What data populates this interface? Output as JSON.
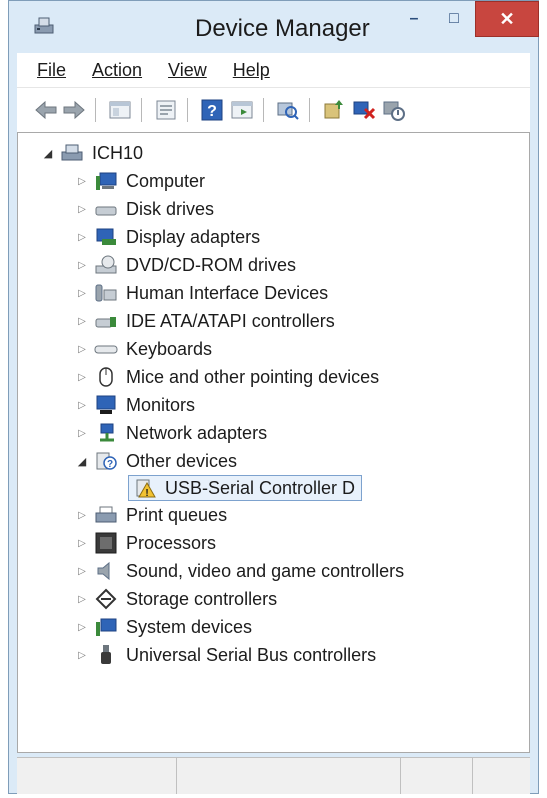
{
  "window": {
    "title": "Device Manager",
    "controls": {
      "minimize": "–",
      "maximize": "□",
      "close": "✕"
    }
  },
  "menu": [
    "File",
    "Action",
    "View",
    "Help"
  ],
  "toolbar": {
    "buttons": [
      "back-icon",
      "forward-icon",
      "show-hide-console-tree-icon",
      "properties-icon",
      "help-icon",
      "action-pane-icon",
      "scan-hardware-changes-icon",
      "update-driver-icon",
      "uninstall-device-icon",
      "disable-device-icon"
    ]
  },
  "tree": {
    "root": "ICH10",
    "categories": [
      {
        "label": "Computer",
        "icon": "computer-icon"
      },
      {
        "label": "Disk drives",
        "icon": "disk-drive-icon"
      },
      {
        "label": "Display adapters",
        "icon": "display-adapter-icon"
      },
      {
        "label": "DVD/CD-ROM drives",
        "icon": "dvd-drive-icon"
      },
      {
        "label": "Human Interface Devices",
        "icon": "hid-icon"
      },
      {
        "label": "IDE ATA/ATAPI controllers",
        "icon": "ide-controller-icon"
      },
      {
        "label": "Keyboards",
        "icon": "keyboard-icon"
      },
      {
        "label": "Mice and other pointing devices",
        "icon": "mouse-icon"
      },
      {
        "label": "Monitors",
        "icon": "monitor-icon"
      },
      {
        "label": "Network adapters",
        "icon": "network-adapter-icon"
      },
      {
        "label": "Other devices",
        "icon": "other-devices-icon",
        "expanded": true
      },
      {
        "label": "USB-Serial Controller D",
        "icon": "warning-device-icon",
        "child": true,
        "selected": true
      },
      {
        "label": "Print queues",
        "icon": "printer-icon"
      },
      {
        "label": "Processors",
        "icon": "processor-icon"
      },
      {
        "label": "Sound, video and game controllers",
        "icon": "speaker-icon"
      },
      {
        "label": "Storage controllers",
        "icon": "storage-controller-icon"
      },
      {
        "label": "System devices",
        "icon": "system-devices-icon"
      },
      {
        "label": "Universal Serial Bus controllers",
        "icon": "usb-icon"
      }
    ]
  },
  "colors": {
    "titlebar": "#dbeaf7",
    "close": "#c8463f",
    "selection": "#e8f1fb"
  }
}
